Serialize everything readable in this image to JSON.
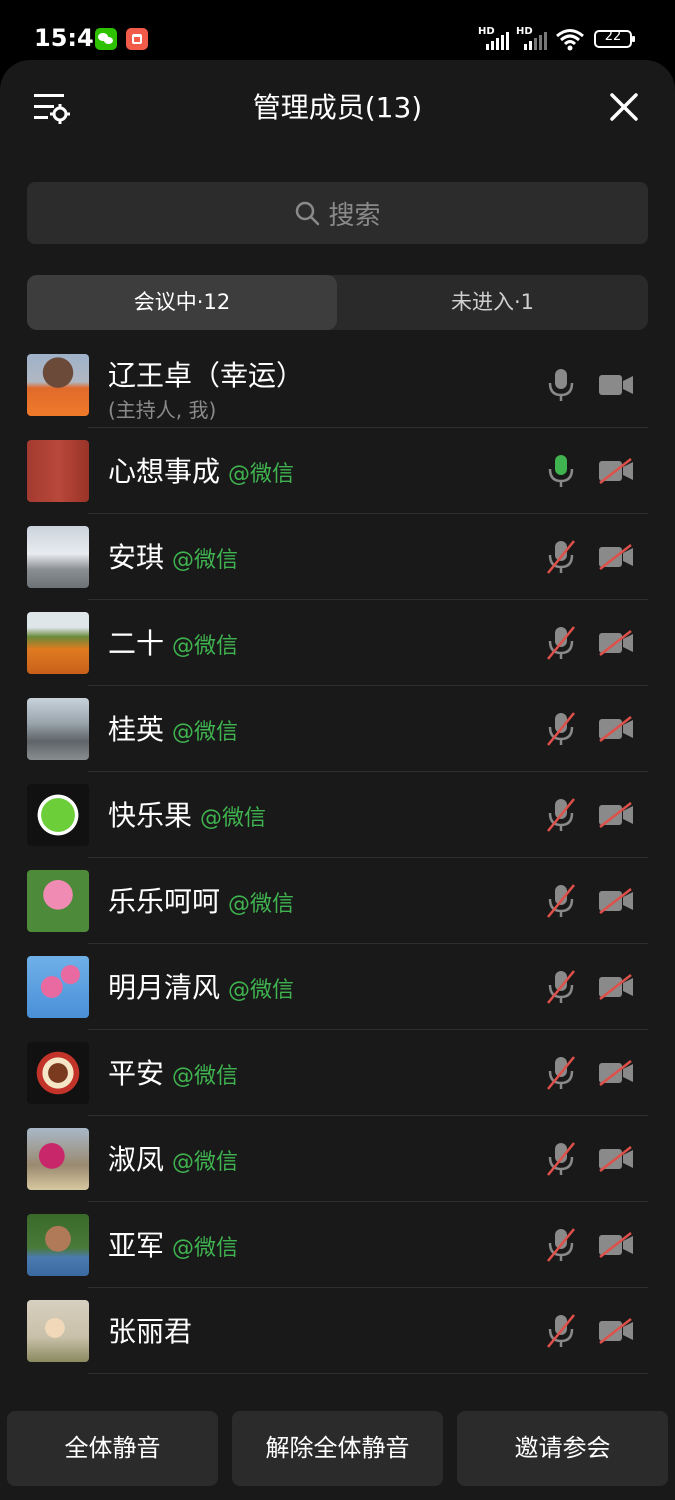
{
  "status_bar": {
    "time": "15:41",
    "signal_1_label": "HD",
    "signal_2_label": "HD",
    "battery": "22"
  },
  "header": {
    "title": "管理成员(13)"
  },
  "search": {
    "placeholder": "搜索"
  },
  "tabs": [
    {
      "label": "会议中·12"
    },
    {
      "label": "未进入·1"
    }
  ],
  "members": [
    {
      "name": "辽王卓（幸运）",
      "tag": "",
      "subtitle": "(主持人, 我)",
      "mic": "on",
      "cam": "on"
    },
    {
      "name": "心想事成",
      "tag": "@微信",
      "subtitle": "",
      "mic": "on",
      "cam": "off"
    },
    {
      "name": "安琪",
      "tag": "@微信",
      "subtitle": "",
      "mic": "off",
      "cam": "off"
    },
    {
      "name": "二十",
      "tag": "@微信",
      "subtitle": "",
      "mic": "off",
      "cam": "off"
    },
    {
      "name": "桂英",
      "tag": "@微信",
      "subtitle": "",
      "mic": "off",
      "cam": "off"
    },
    {
      "name": "快乐果",
      "tag": "@微信",
      "subtitle": "",
      "mic": "off",
      "cam": "off"
    },
    {
      "name": "乐乐呵呵",
      "tag": "@微信",
      "subtitle": "",
      "mic": "off",
      "cam": "off"
    },
    {
      "name": "明月清风",
      "tag": "@微信",
      "subtitle": "",
      "mic": "off",
      "cam": "off"
    },
    {
      "name": "平安",
      "tag": "@微信",
      "subtitle": "",
      "mic": "off",
      "cam": "off"
    },
    {
      "name": "淑凤",
      "tag": "@微信",
      "subtitle": "",
      "mic": "off",
      "cam": "off"
    },
    {
      "name": "亚军",
      "tag": "@微信",
      "subtitle": "",
      "mic": "off",
      "cam": "off"
    },
    {
      "name": "张丽君",
      "tag": "",
      "subtitle": "",
      "mic": "off",
      "cam": "off"
    }
  ],
  "bottom_buttons": {
    "mute_all": "全体静音",
    "unmute_all": "解除全体静音",
    "invite": "邀请参会"
  },
  "colors": {
    "background": "#191919",
    "accent_green": "#3fb34f",
    "muted_red": "#e0504a"
  }
}
